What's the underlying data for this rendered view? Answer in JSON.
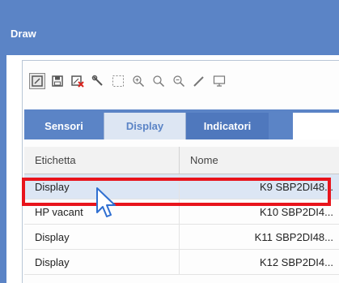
{
  "window": {
    "title": "Draw"
  },
  "toolbar": {
    "buttons": [
      {
        "icon": "edit-icon"
      },
      {
        "icon": "save-icon"
      },
      {
        "icon": "delete-icon"
      },
      {
        "icon": "wrench-icon"
      },
      {
        "icon": "select-rect-icon"
      },
      {
        "icon": "zoom-in-icon"
      },
      {
        "icon": "zoom-icon"
      },
      {
        "icon": "zoom-out-icon"
      },
      {
        "icon": "pencil-icon"
      },
      {
        "icon": "monitor-icon"
      }
    ]
  },
  "tabs": [
    {
      "label": "Sensori",
      "active": false
    },
    {
      "label": "Display",
      "active": true
    },
    {
      "label": "Indicatori",
      "active": false
    }
  ],
  "grid": {
    "columns": [
      "Etichetta",
      "Nome"
    ],
    "rows": [
      {
        "etichetta": "Display",
        "nome": "K9 SBP2DI48...",
        "selected": true
      },
      {
        "etichetta": "HP vacant",
        "nome": "K10 SBP2DI4...",
        "selected": false
      },
      {
        "etichetta": "Display",
        "nome": "K11 SBP2DI48...",
        "selected": false
      },
      {
        "etichetta": "Display",
        "nome": "K12 SBP2DI4...",
        "selected": false
      }
    ]
  },
  "colors": {
    "header_blue": "#5b84c6",
    "selected_row": "#dce6f4",
    "highlight_red": "#e8141c"
  }
}
